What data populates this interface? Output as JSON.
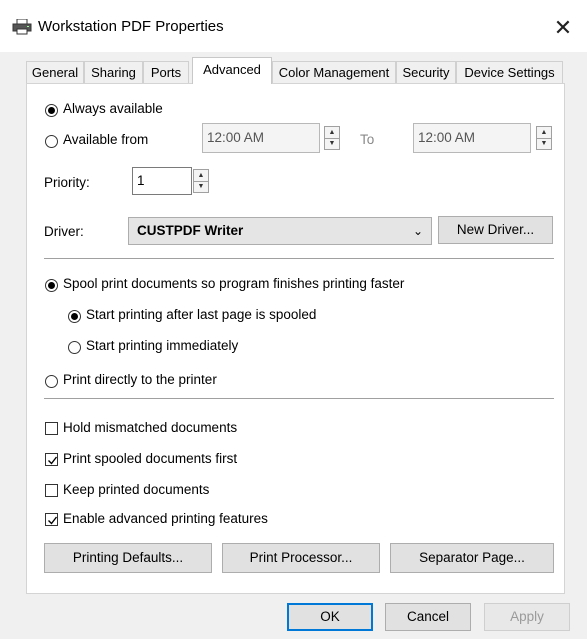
{
  "window": {
    "title": "Workstation PDF Properties",
    "close_glyph": "✕"
  },
  "tabs": [
    {
      "label": "General"
    },
    {
      "label": "Sharing"
    },
    {
      "label": "Ports"
    },
    {
      "label": "Advanced"
    },
    {
      "label": "Color Management"
    },
    {
      "label": "Security"
    },
    {
      "label": "Device Settings"
    }
  ],
  "availability": {
    "always_label": "Always available",
    "from_label": "Available from",
    "from_time": "12:00 AM",
    "to_label": "To",
    "to_time": "12:00 AM",
    "selected": "always"
  },
  "priority": {
    "label": "Priority:",
    "value": "1"
  },
  "driver": {
    "label": "Driver:",
    "selected": "CUSTPDF Writer",
    "new_driver_label": "New Driver..."
  },
  "spool": {
    "spool_label": "Spool print documents so program finishes printing faster",
    "after_last_page_label": "Start printing after last page is spooled",
    "immediately_label": "Start printing immediately",
    "direct_label": "Print directly to the printer",
    "selected": "spool",
    "start_mode": "after_last_page"
  },
  "options": [
    {
      "label": "Hold mismatched documents",
      "checked": false
    },
    {
      "label": "Print spooled documents first",
      "checked": true
    },
    {
      "label": "Keep printed documents",
      "checked": false
    },
    {
      "label": "Enable advanced printing features",
      "checked": true
    }
  ],
  "buttons": {
    "printing_defaults": "Printing Defaults...",
    "print_processor": "Print Processor...",
    "separator_page": "Separator Page...",
    "ok": "OK",
    "cancel": "Cancel",
    "apply": "Apply"
  }
}
